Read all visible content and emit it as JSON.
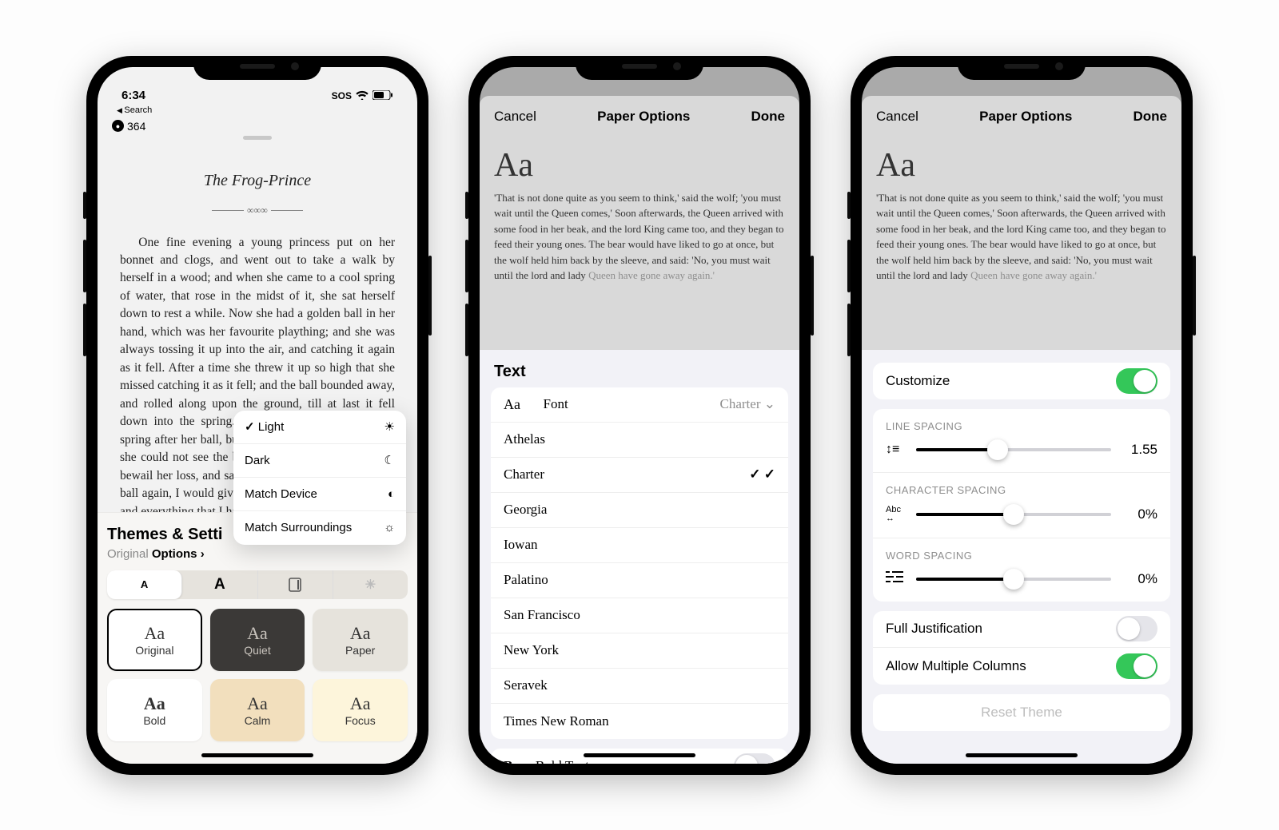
{
  "phone1": {
    "time": "6:34",
    "sos": "SOS",
    "breadcrumb": "Search",
    "page_count": "364",
    "story": {
      "title": "The Frog-Prince",
      "body": "One fine evening a young princess put on her bonnet and clogs, and went out to take a walk by herself in a wood; and when she came to a cool spring of water, that rose in the midst of it, she sat herself down to rest a while. Now she had a golden ball in her hand, which was her favourite plaything; and she was always tossing it up into the air, and catching it again as it fell. After a time she threw it up so high that she missed catching it as it fell; and the ball bounded away, and rolled along upon the ground, till at last it fell down into the spring. The princess looked into the spring after her ball, but it was very deep, so deep that she could not see the bottom of it. Then she began to bewail her loss, and said, 'Alas! if I could only get my ball again, I would give all my fine clothes and jewels, and everything that I have in the world.'"
    },
    "popover": {
      "light": "Light",
      "dark": "Dark",
      "match_device": "Match Device",
      "match_surroundings": "Match Surroundings"
    },
    "sheet": {
      "title": "Themes & Setti",
      "tab_original": "Original",
      "tab_options": "Options",
      "themes": {
        "original": "Original",
        "quiet": "Quiet",
        "paper": "Paper",
        "bold": "Bold",
        "calm": "Calm",
        "focus": "Focus"
      }
    }
  },
  "phone2": {
    "sheet_title": "Paper Options",
    "cancel": "Cancel",
    "done": "Done",
    "preview_body": "'That is not done quite as you seem to think,' said the wolf; 'you must wait until the Queen comes,' Soon afterwards, the Queen arrived with some food in her beak, and the lord King came too, and they began to feed their young ones. The bear would have liked to go at once, but the wolf held him back by the sleeve, and said: 'No, you must wait until the lord and lady ",
    "preview_grey": "Queen have gone away again.'",
    "section": "Text",
    "font_label": "Font",
    "font_value": "Charter",
    "fonts": [
      "Athelas",
      "Charter",
      "Georgia",
      "Iowan",
      "Palatino",
      "San Francisco",
      "New York",
      "Seravek",
      "Times New Roman"
    ],
    "selected_font": "Charter",
    "bold_text": "Bold Text"
  },
  "phone3": {
    "sheet_title": "Paper Options",
    "cancel": "Cancel",
    "done": "Done",
    "preview_body": "'That is not done quite as you seem to think,' said the wolf; 'you must wait until the Queen comes,' Soon afterwards, the Queen arrived with some food in her beak, and the lord King came too, and they began to feed their young ones. The bear would have liked to go at once, but the wolf held him back by the sleeve, and said: 'No, you must wait until the lord and lady ",
    "preview_grey": "Queen have gone away again.'",
    "customize": "Customize",
    "customize_on": true,
    "line_spacing_label": "LINE SPACING",
    "line_spacing_value": "1.55",
    "char_spacing_label": "CHARACTER SPACING",
    "char_spacing_value": "0%",
    "word_spacing_label": "WORD SPACING",
    "word_spacing_value": "0%",
    "full_justification": "Full Justification",
    "full_justification_on": false,
    "allow_multi_columns": "Allow Multiple Columns",
    "allow_multi_columns_on": true,
    "reset": "Reset Theme"
  }
}
